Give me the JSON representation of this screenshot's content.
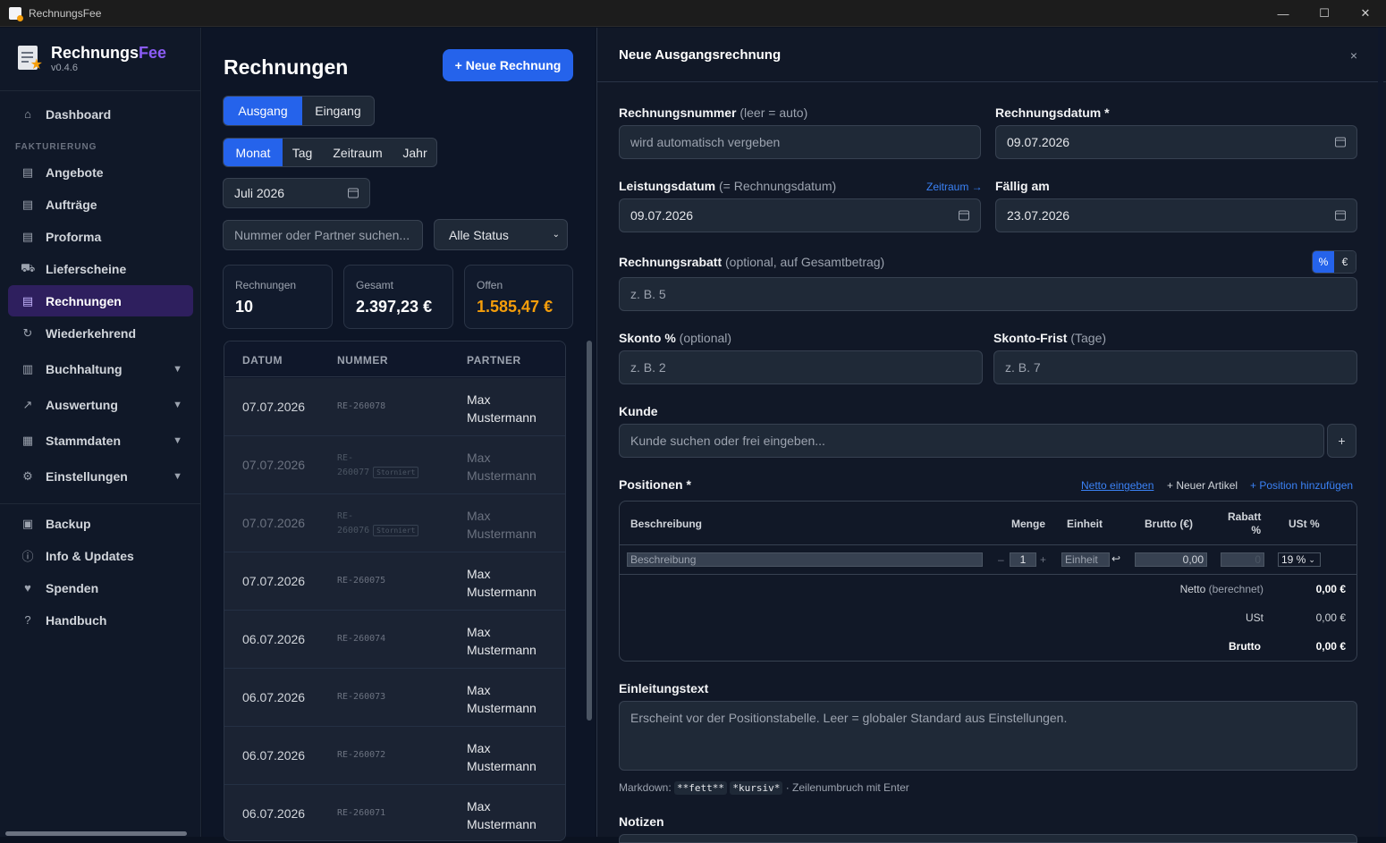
{
  "window": {
    "title": "RechnungsFee",
    "min": "—",
    "max": "☐",
    "close": "✕"
  },
  "brand": {
    "name_a": "Rechnungs",
    "name_b": "Fee",
    "version": "v0.4.6"
  },
  "sidebar": {
    "section": "FAKTURIERUNG",
    "items": [
      {
        "label": "Dashboard",
        "icon": "⌂"
      },
      {
        "label": "Angebote",
        "icon": "▤"
      },
      {
        "label": "Aufträge",
        "icon": "▤"
      },
      {
        "label": "Proforma",
        "icon": "▤"
      },
      {
        "label": "Lieferscheine",
        "icon": "⛟"
      },
      {
        "label": "Rechnungen",
        "icon": "▤"
      },
      {
        "label": "Wiederkehrend",
        "icon": "↻"
      },
      {
        "label": "Buchhaltung",
        "icon": "▥"
      },
      {
        "label": "Auswertung",
        "icon": "↗"
      },
      {
        "label": "Stammdaten",
        "icon": "▦"
      },
      {
        "label": "Einstellungen",
        "icon": "⚙"
      },
      {
        "label": "Backup",
        "icon": "▣"
      },
      {
        "label": "Info & Updates",
        "icon": "ⓘ"
      },
      {
        "label": "Spenden",
        "icon": "♥"
      },
      {
        "label": "Handbuch",
        "icon": "?"
      }
    ],
    "expand_icon": "▼"
  },
  "list": {
    "title": "Rechnungen",
    "new_button": "+ Neue Rechnung",
    "direction": [
      "Ausgang",
      "Eingang"
    ],
    "period": [
      "Monat",
      "Tag",
      "Zeitraum",
      "Jahr"
    ],
    "month_value": "Juli 2026",
    "search_placeholder": "Nummer oder Partner suchen...",
    "status_filter": "Alle Status",
    "stats": [
      {
        "label": "Rechnungen",
        "value": "10"
      },
      {
        "label": "Gesamt",
        "value": "2.397,23 €"
      },
      {
        "label": "Offen",
        "value": "1.585,47 €"
      }
    ],
    "columns": [
      "DATUM",
      "NUMMER",
      "PARTNER"
    ],
    "rows": [
      {
        "date": "07.07.2026",
        "number": "RE-260078",
        "partner_a": "Max",
        "partner_b": "Mustermann"
      },
      {
        "date": "07.07.2026",
        "number_a": "RE-",
        "number_b": "260077",
        "badge": "Storniert",
        "partner_a": "Max",
        "partner_b": "Mustermann"
      },
      {
        "date": "07.07.2026",
        "number_a": "RE-",
        "number_b": "260076",
        "badge": "Storniert",
        "partner_a": "Max",
        "partner_b": "Mustermann"
      },
      {
        "date": "07.07.2026",
        "number": "RE-260075",
        "partner_a": "Max",
        "partner_b": "Mustermann"
      },
      {
        "date": "06.07.2026",
        "number": "RE-260074",
        "partner_a": "Max",
        "partner_b": "Mustermann"
      },
      {
        "date": "06.07.2026",
        "number": "RE-260073",
        "partner_a": "Max",
        "partner_b": "Mustermann"
      },
      {
        "date": "06.07.2026",
        "number": "RE-260072",
        "partner_a": "Max",
        "partner_b": "Mustermann"
      },
      {
        "date": "06.07.2026",
        "number": "RE-260071",
        "partner_a": "Max",
        "partner_b": "Mustermann"
      }
    ]
  },
  "form": {
    "title": "Neue Ausgangsrechnung",
    "close": "×",
    "invoice_number_label": "Rechnungsnummer",
    "invoice_number_hint": "(leer = auto)",
    "invoice_number_placeholder": "wird automatisch vergeben",
    "invoice_date_label": "Rechnungsdatum *",
    "invoice_date": "09.07.2026",
    "service_date_label": "Leistungsdatum",
    "service_date_hint": "(= Rechnungsdatum)",
    "service_period_link": "Zeitraum →",
    "service_date": "09.07.2026",
    "due_label": "Fällig am",
    "due_date": "23.07.2026",
    "discount_label": "Rechnungsrabatt",
    "discount_hint": "(optional, auf Gesamtbetrag)",
    "discount_placeholder": "z. B. 5",
    "discount_modes": [
      "%",
      "€"
    ],
    "skonto_label": "Skonto %",
    "skonto_hint": "(optional)",
    "skonto_placeholder": "z. B. 2",
    "skonto_days_label": "Skonto-Frist",
    "skonto_days_hint": "(Tage)",
    "skonto_days_placeholder": "z. B. 7",
    "customer_label": "Kunde",
    "customer_placeholder": "Kunde suchen oder frei eingeben...",
    "customer_add": "+",
    "positions_label": "Positionen *",
    "net_input_link": "Netto eingeben",
    "new_article_link": "+ Neuer Artikel",
    "add_position_link": "+ Position hinzufügen",
    "pos_columns": {
      "desc": "Beschreibung",
      "qty": "Menge",
      "unit": "Einheit",
      "gross": "Brutto (€)",
      "disc_a": "Rabatt",
      "disc_b": "%",
      "vat": "USt %"
    },
    "pos_row": {
      "desc_placeholder": "Beschreibung",
      "minus": "–",
      "qty": "1",
      "plus": "+",
      "unit_placeholder": "Einheit",
      "unit_icon": "↩",
      "gross": "0,00",
      "disc": "0",
      "vat": "19 %"
    },
    "totals": {
      "net_label": "Netto",
      "net_hint": "(berechnet)",
      "net": "0,00 €",
      "vat_label": "USt",
      "vat": "0,00 €",
      "gross_label": "Brutto",
      "gross": "0,00 €"
    },
    "intro_label": "Einleitungstext",
    "intro_placeholder": "Erscheint vor der Positionstabelle. Leer = globaler Standard aus Einstellungen.",
    "md_hint_a": "Markdown:",
    "md_bold": "**fett**",
    "md_italic": "*kursiv*",
    "md_hint_b": "· Zeilenumbruch mit Enter",
    "notes_label": "Notizen"
  }
}
